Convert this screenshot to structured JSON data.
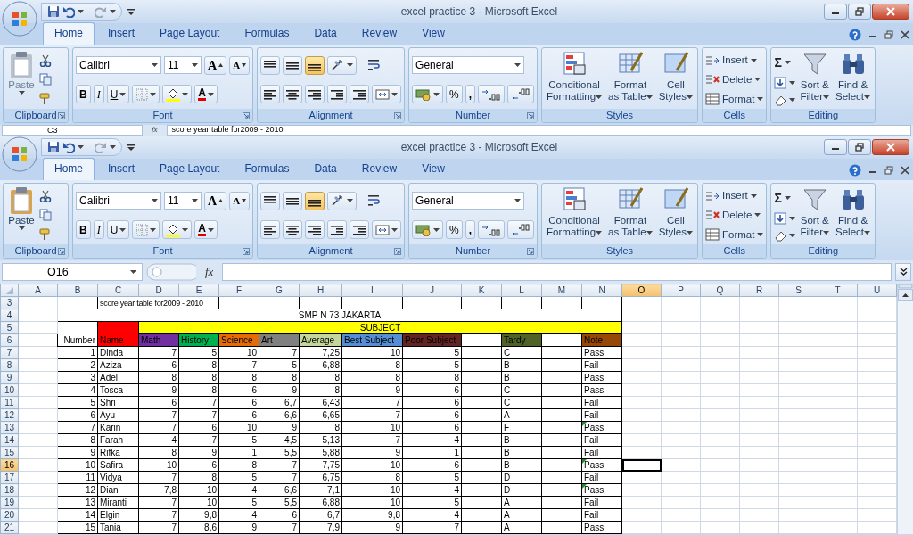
{
  "windows": [
    {
      "title": "excel practice 3 - Microsoft Excel",
      "tabs": [
        {
          "label": "Home",
          "selected": true
        },
        {
          "label": "Insert",
          "selected": false
        },
        {
          "label": "Page Layout",
          "selected": false
        },
        {
          "label": "Formulas",
          "selected": false
        },
        {
          "label": "Data",
          "selected": false
        },
        {
          "label": "Review",
          "selected": false
        },
        {
          "label": "View",
          "selected": false
        }
      ],
      "ribbon": {
        "clipboard": {
          "label": "Clipboard",
          "paste": "Paste",
          "paste_disabled": true
        },
        "font": {
          "label": "Font",
          "name": "Calibri",
          "size": "11",
          "grow": "A",
          "shrink": "A",
          "bold": "B",
          "italic": "I",
          "underline": "U",
          "font_color_letter": "A"
        },
        "alignment": {
          "label": "Alignment",
          "vertical": [
            {
              "selected": false
            },
            {
              "selected": false
            },
            {
              "selected": true
            }
          ]
        },
        "number": {
          "label": "Number",
          "format": "General",
          "percent": "%",
          "comma": ","
        },
        "styles": {
          "label": "Styles",
          "buttons": [
            "Conditional\nFormatting",
            "Format\nas Table",
            "Cell\nStyles"
          ]
        },
        "cells": {
          "label": "Cells",
          "buttons": [
            "Insert",
            "Delete",
            "Format"
          ]
        },
        "editing": {
          "label": "Editing",
          "sum": "Σ",
          "buttons": [
            "Sort &\nFilter",
            "Find &\nSelect"
          ]
        }
      },
      "formula_bar": {
        "name_box": "C3",
        "function_label": "fx",
        "content": "score year table for2009 - 2010"
      }
    },
    {
      "title": "excel practice 3 - Microsoft Excel",
      "tabs": [
        {
          "label": "Home",
          "selected": true
        },
        {
          "label": "Insert",
          "selected": false
        },
        {
          "label": "Page Layout",
          "selected": false
        },
        {
          "label": "Formulas",
          "selected": false
        },
        {
          "label": "Data",
          "selected": false
        },
        {
          "label": "Review",
          "selected": false
        },
        {
          "label": "View",
          "selected": false
        }
      ],
      "ribbon": {
        "clipboard": {
          "label": "Clipboard",
          "paste": "Paste",
          "paste_disabled": false
        },
        "font": {
          "label": "Font",
          "name": "Calibri",
          "size": "11",
          "grow": "A",
          "shrink": "A",
          "bold": "B",
          "italic": "I",
          "underline": "U",
          "font_color_letter": "A"
        },
        "alignment": {
          "label": "Alignment",
          "vertical": [
            {
              "selected": false
            },
            {
              "selected": false
            },
            {
              "selected": true
            }
          ]
        },
        "number": {
          "label": "Number",
          "format": "General",
          "percent": "%",
          "comma": ","
        },
        "styles": {
          "label": "Styles",
          "buttons": [
            "Conditional\nFormatting",
            "Format\nas Table",
            "Cell\nStyles"
          ]
        },
        "cells": {
          "label": "Cells",
          "buttons": [
            "Insert",
            "Delete",
            "Format"
          ]
        },
        "editing": {
          "label": "Editing",
          "sum": "Σ",
          "buttons": [
            "Sort &\nFilter",
            "Find &\nSelect"
          ]
        }
      },
      "formula_bar": {
        "name_box": "O16",
        "function_label": "fx"
      }
    }
  ],
  "sheet": {
    "columns": [
      {
        "label": "A",
        "selected": false
      },
      {
        "label": "B",
        "selected": false
      },
      {
        "label": "C",
        "selected": false
      },
      {
        "label": "D",
        "selected": false
      },
      {
        "label": "E",
        "selected": false
      },
      {
        "label": "F",
        "selected": false
      },
      {
        "label": "G",
        "selected": false
      },
      {
        "label": "H",
        "selected": false
      },
      {
        "label": "I",
        "selected": false
      },
      {
        "label": "J",
        "selected": false
      },
      {
        "label": "K",
        "selected": false
      },
      {
        "label": "L",
        "selected": false
      },
      {
        "label": "M",
        "selected": false
      },
      {
        "label": "N",
        "selected": false
      },
      {
        "label": "O",
        "selected": true
      },
      {
        "label": "P",
        "selected": false
      },
      {
        "label": "Q",
        "selected": false
      },
      {
        "label": "R",
        "selected": false
      },
      {
        "label": "S",
        "selected": false
      },
      {
        "label": "T",
        "selected": false
      },
      {
        "label": "U",
        "selected": false
      }
    ],
    "row_headers": [
      {
        "label": "3",
        "selected": false
      },
      {
        "label": "4",
        "selected": false
      },
      {
        "label": "5",
        "selected": false
      },
      {
        "label": "6",
        "selected": false
      },
      {
        "label": "7",
        "selected": false
      },
      {
        "label": "8",
        "selected": false
      },
      {
        "label": "9",
        "selected": false
      },
      {
        "label": "10",
        "selected": false
      },
      {
        "label": "11",
        "selected": false
      },
      {
        "label": "12",
        "selected": false
      },
      {
        "label": "13",
        "selected": false
      },
      {
        "label": "14",
        "selected": false
      },
      {
        "label": "15",
        "selected": false
      },
      {
        "label": "16",
        "selected": true
      },
      {
        "label": "17",
        "selected": false
      },
      {
        "label": "18",
        "selected": false
      },
      {
        "label": "19",
        "selected": false
      },
      {
        "label": "20",
        "selected": false
      },
      {
        "label": "21",
        "selected": false
      }
    ],
    "caption": "score year table for2009 - 2010",
    "school": "SMP N 73 JAKARTA",
    "group_header": {
      "label": "SUBJECT",
      "color": "#ffff00"
    },
    "number_header": "Number",
    "name_header": {
      "label": "Name",
      "color": "#ff0000"
    },
    "fields": [
      {
        "label": "Math",
        "color": "#7030a0"
      },
      {
        "label": "History",
        "color": "#00b050"
      },
      {
        "label": "Science",
        "color": "#e36c09"
      },
      {
        "label": "Art",
        "color": "#808080"
      },
      {
        "label": "Average",
        "color": "#c3d69b"
      },
      {
        "label": "Best Subject",
        "color": "#558ed5"
      },
      {
        "label": "Poor Subject",
        "color": "#632523"
      },
      {
        "label": "Tardy",
        "color": "#4f6228"
      },
      {
        "label": "Note",
        "color": "#984806"
      }
    ],
    "students": [
      {
        "number": "1",
        "name": "Dinda",
        "scores": [
          "7",
          "5",
          "10",
          "7",
          "7,25",
          "10",
          "5"
        ],
        "tardy": "C",
        "note": "Pass",
        "flagged": false
      },
      {
        "number": "2",
        "name": "Aziza",
        "scores": [
          "6",
          "8",
          "7",
          "5",
          "6,88",
          "8",
          "5"
        ],
        "tardy": "B",
        "note": "Fail",
        "flagged": false
      },
      {
        "number": "3",
        "name": "Adel",
        "scores": [
          "8",
          "8",
          "8",
          "8",
          "8",
          "8",
          "8"
        ],
        "tardy": "B",
        "note": "Pass",
        "flagged": false
      },
      {
        "number": "4",
        "name": "Tosca",
        "scores": [
          "9",
          "8",
          "6",
          "9",
          "8",
          "9",
          "6"
        ],
        "tardy": "C",
        "note": "Pass",
        "flagged": false
      },
      {
        "number": "5",
        "name": "Shri",
        "scores": [
          "6",
          "7",
          "6",
          "6,7",
          "6,43",
          "7",
          "6"
        ],
        "tardy": "C",
        "note": "Fail",
        "flagged": false
      },
      {
        "number": "6",
        "name": "Ayu",
        "scores": [
          "7",
          "7",
          "6",
          "6,6",
          "6,65",
          "7",
          "6"
        ],
        "tardy": "A",
        "note": "Fail",
        "flagged": false
      },
      {
        "number": "7",
        "name": "Karin",
        "scores": [
          "7",
          "6",
          "10",
          "9",
          "8",
          "10",
          "6"
        ],
        "tardy": "F",
        "note": "Pass",
        "flagged": true
      },
      {
        "number": "8",
        "name": "Farah",
        "scores": [
          "4",
          "7",
          "5",
          "4,5",
          "5,13",
          "7",
          "4"
        ],
        "tardy": "B",
        "note": "Fail",
        "flagged": false
      },
      {
        "number": "9",
        "name": "Rifka",
        "scores": [
          "8",
          "9",
          "1",
          "5,5",
          "5,88",
          "9",
          "1"
        ],
        "tardy": "B",
        "note": "Fail",
        "flagged": false
      },
      {
        "number": "10",
        "name": "Safira",
        "scores": [
          "10",
          "6",
          "8",
          "7",
          "7,75",
          "10",
          "6"
        ],
        "tardy": "B",
        "note": "Pass",
        "flagged": true
      },
      {
        "number": "11",
        "name": "Vidya",
        "scores": [
          "7",
          "8",
          "5",
          "7",
          "6,75",
          "8",
          "5"
        ],
        "tardy": "D",
        "note": "Fail",
        "flagged": false
      },
      {
        "number": "12",
        "name": "Dian",
        "scores": [
          "7,8",
          "10",
          "4",
          "6,6",
          "7,1",
          "10",
          "4"
        ],
        "tardy": "D",
        "note": "Pass",
        "flagged": true
      },
      {
        "number": "13",
        "name": "Miranti",
        "scores": [
          "7",
          "10",
          "5",
          "5,5",
          "6,88",
          "10",
          "5"
        ],
        "tardy": "A",
        "note": "Fail",
        "flagged": false
      },
      {
        "number": "14",
        "name": "Elgin",
        "scores": [
          "7",
          "9,8",
          "4",
          "6",
          "6,7",
          "9,8",
          "4"
        ],
        "tardy": "A",
        "note": "Fail",
        "flagged": false
      },
      {
        "number": "15",
        "name": "Tania",
        "scores": [
          "7",
          "8,6",
          "9",
          "7",
          "7,9",
          "9",
          "7"
        ],
        "tardy": "A",
        "note": "Pass",
        "flagged": false
      }
    ]
  }
}
